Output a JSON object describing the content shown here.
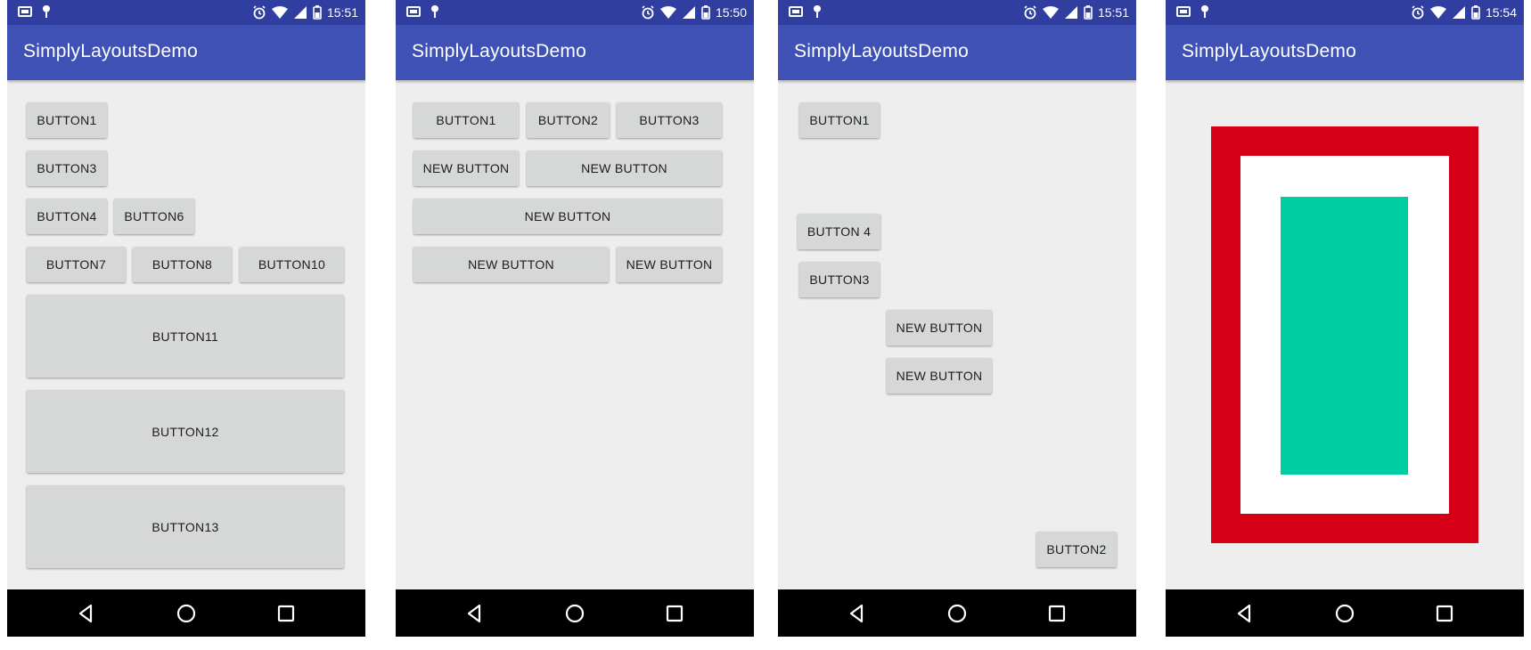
{
  "colors": {
    "status_bar": "#303f9f",
    "app_bar": "#3f51b5",
    "background": "#eeeeee",
    "button": "#d6d7d7",
    "nav_bar": "#000000",
    "frame_red": "#d50016",
    "frame_white": "#ffffff",
    "inner_green": "#00cea2"
  },
  "screens": [
    {
      "status": {
        "time": "15:51"
      },
      "app_title": "SimplyLayoutsDemo",
      "buttons": [
        "BUTTON1",
        "BUTTON3",
        "BUTTON4",
        "BUTTON6",
        "BUTTON7",
        "BUTTON8",
        "BUTTON10",
        "BUTTON11",
        "BUTTON12",
        "BUTTON13"
      ]
    },
    {
      "status": {
        "time": "15:50"
      },
      "app_title": "SimplyLayoutsDemo",
      "buttons": [
        "BUTTON1",
        "BUTTON2",
        "BUTTON3",
        "NEW BUTTON",
        "NEW BUTTON",
        "NEW BUTTON",
        "NEW BUTTON",
        "NEW BUTTON"
      ]
    },
    {
      "status": {
        "time": "15:51"
      },
      "app_title": "SimplyLayoutsDemo",
      "buttons": [
        "BUTTON1",
        "BUTTON 4",
        "BUTTON3",
        "NEW BUTTON",
        "NEW BUTTON",
        "BUTTON2"
      ]
    },
    {
      "status": {
        "time": "15:54"
      },
      "app_title": "SimplyLayoutsDemo",
      "buttons": []
    }
  ],
  "status_icons": [
    "image-notification-icon",
    "dropper-notification-icon",
    "alarm-icon",
    "wifi-icon",
    "signal-icon",
    "battery-icon"
  ],
  "nav_icons": [
    "back-icon",
    "home-icon",
    "recents-icon"
  ]
}
